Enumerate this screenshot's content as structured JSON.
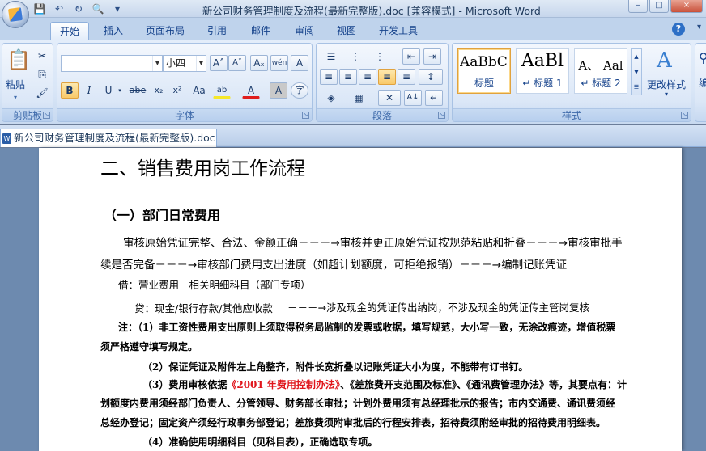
{
  "window": {
    "title": "新公司财务管理制度及流程(最新完整版).doc [兼容模式] - Microsoft Word",
    "controls": [
      "–",
      "□",
      "×"
    ]
  },
  "qat": {
    "icons": [
      "save-icon",
      "undo-icon",
      "redo-icon",
      "print-preview-icon",
      "customize-icon"
    ],
    "glyphs": [
      "💾",
      "↶",
      "↻",
      "🔍",
      "▾"
    ]
  },
  "tabs": [
    "开始",
    "插入",
    "页面布局",
    "引用",
    "邮件",
    "审阅",
    "视图",
    "开发工具"
  ],
  "active_tab": "开始",
  "help_glyph": "?",
  "ribbon": {
    "clipboard": {
      "label": "剪贴板",
      "paste": "粘贴",
      "paste_glyph": "📋",
      "cut_glyph": "✂",
      "copy_glyph": "⎘",
      "painter_glyph": "🖌"
    },
    "font": {
      "label": "字体",
      "font_name": "",
      "font_size": "小四",
      "grow": "A˄",
      "shrink": "A˅",
      "clear": "Aₓ",
      "phonetic": "wén",
      "border_char": "A",
      "bold": "B",
      "italic": "I",
      "underline": "U",
      "strike": "abe",
      "subscript": "x₂",
      "superscript": "x²",
      "change_case": "Aa",
      "highlight": "ab",
      "font_color": "A",
      "char_shade": "A",
      "enclose": "字"
    },
    "paragraph": {
      "label": "段落",
      "bullets": "☰",
      "numbering": "⋮",
      "multilevel": "⋮",
      "dec_indent": "⇤",
      "inc_indent": "⇥",
      "align_left": "≡",
      "center": "≡",
      "align_right": "≡",
      "justify": "≡",
      "distribute": "≡",
      "line_spacing": "↕",
      "shading": "◈",
      "borders": "▦",
      "chinese_layout": "✕",
      "sort": "A↓",
      "show_marks": "↵"
    },
    "styles": {
      "label": "样式",
      "items": [
        {
          "sample": "AaBbC(",
          "name": "标题"
        },
        {
          "sample": "AaBl",
          "name": "↵ 标题 1"
        },
        {
          "sample": "A、 Aal",
          "name": "↵ 标题 2"
        }
      ],
      "change_styles": "更改样式",
      "change_styles_icon_glyph": "A"
    },
    "edit_partial": "编"
  },
  "doc_tab": "新公司财务管理制度及流程(最新完整版).doc",
  "document": {
    "h2": "二、销售费用岗工作流程",
    "h3": "（一）部门日常费用",
    "p1_line1": "审核原始凭证完整、合法、金额正确－－－→审核并更正原始凭证按规范粘贴和折叠－－－→审核审批手",
    "p1_line2": "续是否完备－－－→审核部门费用支出进度（如超计划额度，可拒绝报销）－－－→编制记账凭证",
    "debit": "借：营业费用－相关明细科目（部门专项）",
    "credit": "贷：现金/银行存款/其他应收款",
    "credit_tail": "－－－→涉及现金的凭证传出纳岗，不涉及现金的凭证传主管岗复核",
    "note1_line1": "注：（1）非工资性费用支出原则上须取得税务局监制的发票或收据，填写规范，大小写一致，无涂改痕迹，增值税票",
    "note1_line2": "须严格遵守填写规定。",
    "note2": "（2）保证凭证及附件左上角整齐，附件长宽折叠以记账凭证大小为度，不能带有订书钉。",
    "note3_pre": "（3）费用审核依据",
    "note3_red": "《2001 年费用控制办法》",
    "note3_post": "、《差旅费开支范围及标准》、《通讯费管理办法》等，其要点有：计",
    "note3_line2": "划额度内费用须经部门负责人、分管领导、财务部长审批；计划外费用须有总经理批示的报告；市内交通费、通讯费须经",
    "note3_line3": "总经办登记；固定资产须经行政事务部登记；差旅费须附审批后的行程安排表，招待费须附经审批的招待费用明细表。",
    "note4": "（4）准确使用明细科目（见科目表），正确选取专项。"
  }
}
